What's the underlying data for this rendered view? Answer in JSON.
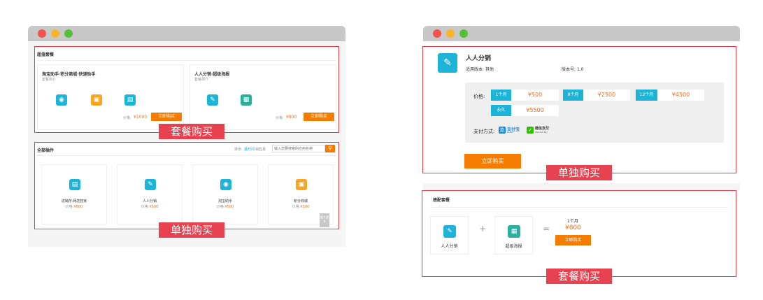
{
  "left": {
    "section1_title": "超值套餐",
    "pkg1": {
      "title": "淘宝助手·积分商城·快递助手",
      "desc": "套餐简介",
      "price_label": "价格:",
      "price": "¥1000",
      "btn": "立即购买"
    },
    "pkg2": {
      "title": "人人分销·超级海报",
      "desc": "套餐简介",
      "price_label": "价格:",
      "price": "¥800",
      "btn": "立即购买"
    },
    "tag1": "套餐购买",
    "section2_title": "全部插件",
    "sort_label": "排序:",
    "sort_opt1": "最时间",
    "sort_opt2": "销售量",
    "search_placeholder": "输入您要搜索的应用名称",
    "plugins": [
      {
        "name": "进销存·网店管家",
        "price_label": "价格:",
        "price": "¥800"
      },
      {
        "name": "人人分销",
        "price_label": "价格:",
        "price": "¥500"
      },
      {
        "name": "淘宝助手",
        "price_label": "价格:",
        "price": "¥500"
      },
      {
        "name": "积分商城",
        "price_label": "价格:",
        "price": "¥300"
      }
    ],
    "more_btn": "展开更多",
    "tag2": "单独购买"
  },
  "right": {
    "app_name": "人人分销",
    "version_label": "适用版本:",
    "version_value": "其他",
    "build_label": "版本号:",
    "build_value": "1.0",
    "price_label": "价格:",
    "prices": [
      {
        "period": "1个月",
        "price": "¥500"
      },
      {
        "period": "6个月",
        "price": "¥2500"
      },
      {
        "period": "12个月",
        "price": "¥4500"
      },
      {
        "period": "永久",
        "price": "¥5500"
      }
    ],
    "pay_label": "支付方式:",
    "alipay": "支付宝",
    "alipay_sub": "ALIPAY",
    "wechat": "微信支付",
    "wechat_sub": "WeChat Pay",
    "buy_btn": "立即购买",
    "tag1": "单独购买",
    "combo_title": "搭配套餐",
    "combo_item1": "人人分销",
    "combo_item2": "超级海报",
    "combo_period": "1个月",
    "combo_price": "¥800",
    "combo_btn": "立即购买",
    "tag2": "套餐购买"
  },
  "colors": {
    "accent_orange": "#f57c00",
    "tag_red": "#e8414f",
    "cyan": "#1eb4d8"
  }
}
